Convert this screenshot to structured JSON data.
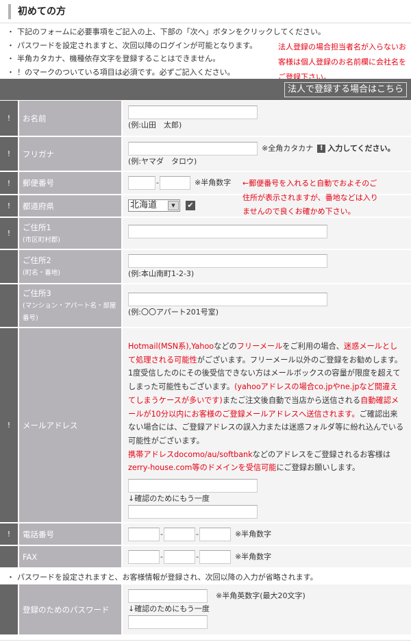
{
  "title": "初めての方",
  "notes": [
    "下記のフォームに必要事項をご記入の上、下部の「次へ」ボタンをクリックしてください。",
    "パスワードを設定されますと、次回以降のログインが可能となります。",
    "半角カタカナ、機種依存文字を登録することはできません。",
    "！のマークのついている項目は必須です。必ずご記入ください。"
  ],
  "corp_note": "法人登録の場合担当者名が入らないお客様は個人登録のお名前欄に会社名をご登録下さい。",
  "corp_button": "法人で登録する場合はこちら",
  "required_mark": "!",
  "colors": {
    "accent_red": "#e60012",
    "mark_bg": "#666666",
    "label_bg": "#b5b2b8",
    "value_bg": "#f4f4f4"
  },
  "fields": {
    "name": {
      "label": "お名前",
      "hint": "(例:山田　太郎)"
    },
    "kana": {
      "label": "フリガナ",
      "note": "※全角カタカナ",
      "warn": "入力してください。",
      "hint": "(例:ヤマダ　タロウ)"
    },
    "zip": {
      "label": "郵便番号",
      "note": "※半角数字",
      "sep": "-",
      "red_note": "←郵便番号を入れると自動でおよそのご住所が表示されますが、番地などは入りませんので良くお確かめ下さい。"
    },
    "pref": {
      "label": "都道府県",
      "selected": "北海道"
    },
    "addr1": {
      "label": "ご住所1",
      "sub": "(市区町村郡)"
    },
    "addr2": {
      "label": "ご住所2",
      "sub": "(町名・番地)",
      "hint": "(例:本山南町1-2-3)"
    },
    "addr3": {
      "label": "ご住所3",
      "sub": "(マンション・アパート名・部屋番号)",
      "hint": "(例:〇〇アパート201号室)"
    },
    "email": {
      "label": "メールアドレス",
      "confirm": "↓確認のためにもう一度",
      "message": [
        {
          "text": "Hotmail(MSN系),Yahoo",
          "red": true
        },
        {
          "text": "などの",
          "red": false
        },
        {
          "text": "フリーメール",
          "red": true
        },
        {
          "text": "をご利用の場合、",
          "red": false
        },
        {
          "text": "迷惑メールとして処理される可能性",
          "red": true
        },
        {
          "text": "がございます。フリーメール以外のご登録をお勧めします。1度受信したのにその後受信できない方はメールボックスの容量が限度を超えてしまった可能性もございます。",
          "red": false
        },
        {
          "text": "(yahooアドレスの場合co.jpやne.jpなど間違えてしまうケースが多いです)",
          "red": true
        },
        {
          "text": "またご注文後自動で当店から送信される",
          "red": false
        },
        {
          "text": "自動確認メールが10分以内にお客様のご登録メールアドレスへ送信されます。",
          "red": true
        },
        {
          "text": "ご確認出来ない場合には、ご登録アドレスの誤入力または迷惑フォルダ等に紛れ込んでいる可能性がございます。",
          "red": false,
          "br": true
        },
        {
          "text": "携帯アドレスdocomo/au/softbank",
          "red": true
        },
        {
          "text": "などのアドレスをご登録されるお客様は",
          "red": false
        },
        {
          "text": "zerry-house.com等のドメインを受信可能",
          "red": true
        },
        {
          "text": "にご登録お願いします。",
          "red": false
        }
      ]
    },
    "tel": {
      "label": "電話番号",
      "note": "※半角数字",
      "sep": "-"
    },
    "fax": {
      "label": "FAX",
      "note": "※半角数字",
      "sep": "-"
    },
    "password": {
      "label": "登録のためのパスワード",
      "note": "※半角英数字(最大20文字)",
      "confirm": "↓確認のためにもう一度"
    }
  },
  "password_note": "パスワードを設定されますと、お客様情報が登録され、次回以降の入力が省略されます。"
}
